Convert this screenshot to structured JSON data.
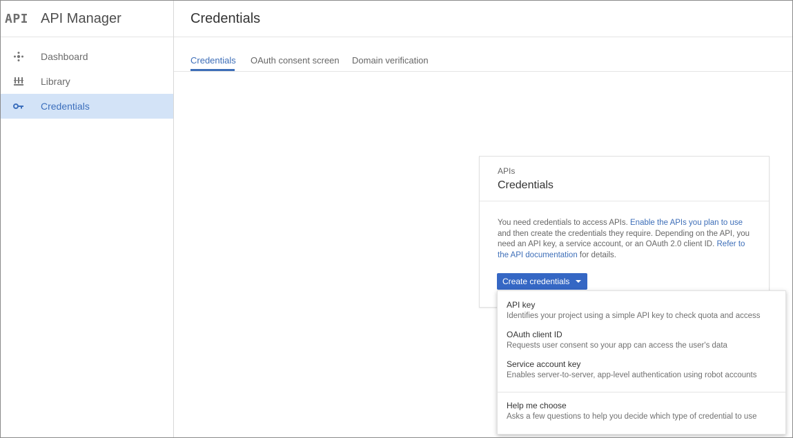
{
  "app": {
    "logo": "API",
    "name": "API Manager"
  },
  "sidebar": {
    "items": [
      {
        "label": "Dashboard",
        "icon": "dashboard-icon"
      },
      {
        "label": "Library",
        "icon": "library-icon"
      },
      {
        "label": "Credentials",
        "icon": "key-icon",
        "active": true
      }
    ]
  },
  "header": {
    "title": "Credentials"
  },
  "tabs": [
    {
      "label": "Credentials",
      "active": true
    },
    {
      "label": "OAuth consent screen"
    },
    {
      "label": "Domain verification"
    }
  ],
  "card": {
    "kicker": "APIs",
    "title": "Credentials",
    "body": {
      "text1": "You need credentials to access APIs. ",
      "link1": "Enable the APIs you plan to use",
      "text2": " and then create the credentials they require. Depending on the API, you need an API key, a service account, or an OAuth 2.0 client ID. ",
      "link2": "Refer to the API documentation",
      "text3": " for details."
    },
    "button_label": "Create credentials"
  },
  "menu": {
    "items": [
      {
        "title": "API key",
        "desc": "Identifies your project using a simple API key to check quota and access"
      },
      {
        "title": "OAuth client ID",
        "desc": "Requests user consent so your app can access the user's data"
      },
      {
        "title": "Service account key",
        "desc": "Enables server-to-server, app-level authentication using robot accounts"
      },
      {
        "title": "Help me choose",
        "desc": "Asks a few questions to help you decide which type of credential to use"
      }
    ]
  },
  "colors": {
    "accent": "#3567c4",
    "active_nav_bg": "#d3e3f7",
    "link": "#3d6eb8"
  }
}
